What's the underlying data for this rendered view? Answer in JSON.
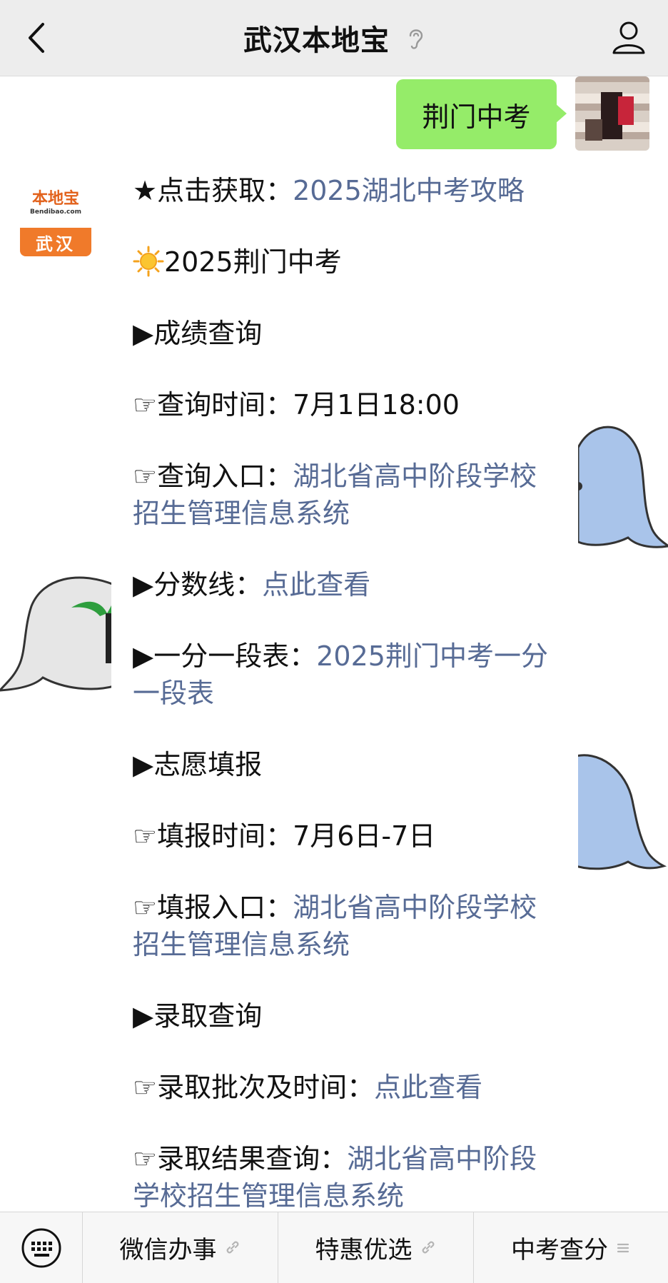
{
  "header": {
    "title": "武汉本地宝",
    "back_icon": "chevron-left-icon",
    "ear_icon": "ear-icon",
    "profile_icon": "person-icon"
  },
  "sent_message": {
    "text": "荆门中考"
  },
  "bot_avatar": {
    "logo_text": "本地宝",
    "logo_site": "Bendibao.com",
    "city": "武汉"
  },
  "message": {
    "lines": [
      {
        "prefix": "★点击获取：",
        "link": "2025湖北中考攻略"
      },
      {
        "prefix": "2025荆门中考",
        "icon": "sun-icon"
      },
      {
        "prefix": "▶成绩查询"
      },
      {
        "prefix": "☞查询时间：7月1日18:00"
      },
      {
        "prefix": "☞查询入口：",
        "link": "湖北省高中阶段学校招生管理信息系统"
      },
      {
        "prefix": "▶分数线：",
        "link": "点此查看"
      },
      {
        "prefix": "▶一分一段表：",
        "link": "2025荆门中考一分一段表"
      },
      {
        "prefix": "▶志愿填报"
      },
      {
        "prefix": "☞填报时间：7月6日-7日"
      },
      {
        "prefix": "☞填报入口：",
        "link": "湖北省高中阶段学校招生管理信息系统"
      },
      {
        "prefix": "▶录取查询"
      },
      {
        "prefix": "☞录取批次及时间：",
        "link": "点此查看"
      },
      {
        "prefix": "☞录取结果查询：",
        "link": "湖北省高中阶段学校招生管理信息系统"
      }
    ]
  },
  "menu": {
    "keyboard_icon": "keyboard-icon",
    "items": [
      {
        "label": "微信办事",
        "icon": "link-icon"
      },
      {
        "label": "特惠优选",
        "icon": "link-icon"
      },
      {
        "label": "中考查分",
        "icon": "menu-lines-icon"
      }
    ]
  },
  "colors": {
    "header_bg": "#ededed",
    "sent_bubble": "#95ec69",
    "link": "#576b95",
    "brand_orange": "#f07a2a"
  }
}
